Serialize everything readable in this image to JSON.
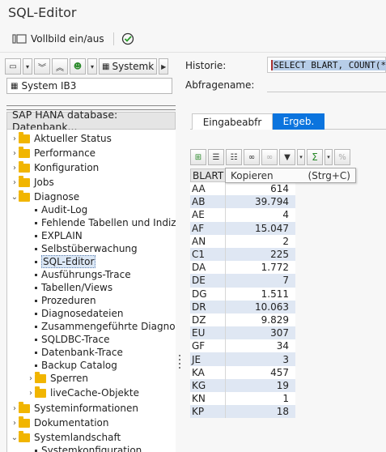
{
  "title": "SQL-Editor",
  "toolbar": {
    "fullscreen_label": "Vollbild ein/aus"
  },
  "left": {
    "system_dropdown": "Systemk",
    "system_selected": "System IB3",
    "tree_header": "SAP HANA database: Datenbank...",
    "nodes": [
      {
        "label": "Aktueller Status"
      },
      {
        "label": "Performance"
      },
      {
        "label": "Konfiguration"
      },
      {
        "label": "Jobs"
      },
      {
        "label": "Diagnose"
      },
      {
        "label": "Audit-Log"
      },
      {
        "label": "Fehlende Tabellen und Indizes"
      },
      {
        "label": "EXPLAIN"
      },
      {
        "label": "Selbstüberwachung"
      },
      {
        "label": "SQL-Editor"
      },
      {
        "label": "Ausführungs-Trace"
      },
      {
        "label": "Tabellen/Views"
      },
      {
        "label": "Prozeduren"
      },
      {
        "label": "Diagnosedateien"
      },
      {
        "label": "Zusammengeführte Diagnosedateien"
      },
      {
        "label": "SQLDBC-Trace"
      },
      {
        "label": "Datenbank-Trace"
      },
      {
        "label": "Backup Catalog"
      },
      {
        "label": "Sperren"
      },
      {
        "label": "liveCache-Objekte"
      },
      {
        "label": "Systeminformationen"
      },
      {
        "label": "Dokumentation"
      },
      {
        "label": "Systemlandschaft"
      },
      {
        "label": "Systemkonfiguration"
      }
    ]
  },
  "right": {
    "historie_label": "Historie:",
    "sql_text": "SELECT BLART, COUNT(*",
    "abfragename_label": "Abfragename:",
    "tab_input": "Eingabeabfr",
    "tab_result": "Ergeb.",
    "tooltip_text": "Kopieren",
    "tooltip_shortcut": "(Strg+C)",
    "grid": {
      "col1": "BLART",
      "rows": [
        {
          "blart": "AA",
          "count": "614"
        },
        {
          "blart": "AB",
          "count": "39.794"
        },
        {
          "blart": "AE",
          "count": "4"
        },
        {
          "blart": "AF",
          "count": "15.047"
        },
        {
          "blart": "AN",
          "count": "2"
        },
        {
          "blart": "C1",
          "count": "225"
        },
        {
          "blart": "DA",
          "count": "1.772"
        },
        {
          "blart": "DE",
          "count": "7"
        },
        {
          "blart": "DG",
          "count": "1.511"
        },
        {
          "blart": "DR",
          "count": "10.063"
        },
        {
          "blart": "DZ",
          "count": "9.829"
        },
        {
          "blart": "EU",
          "count": "307"
        },
        {
          "blart": "GF",
          "count": "34"
        },
        {
          "blart": "JE",
          "count": "3"
        },
        {
          "blart": "KA",
          "count": "457"
        },
        {
          "blart": "KG",
          "count": "19"
        },
        {
          "blart": "KN",
          "count": "1"
        },
        {
          "blart": "KP",
          "count": "18"
        }
      ]
    }
  },
  "colors": {
    "accent": "#0b74de",
    "folder": "#f1b500",
    "row_alt": "#dfe7f3"
  }
}
